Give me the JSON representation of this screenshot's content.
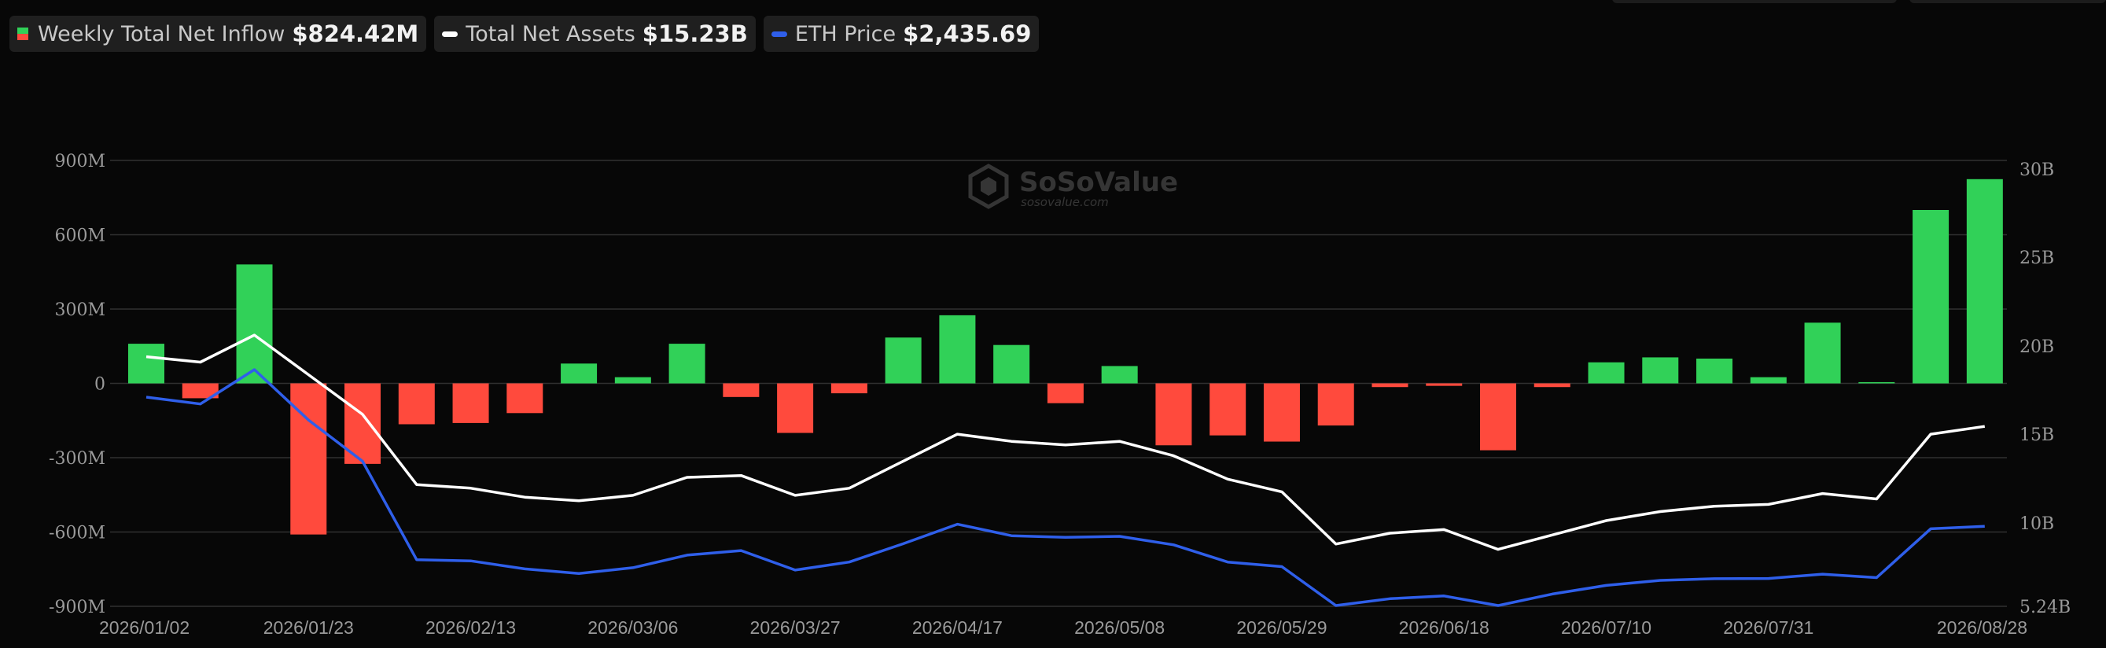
{
  "legend": {
    "inflow_label": "Weekly Total Net Inflow",
    "inflow_value": "$824.42M",
    "assets_label": "Total Net Assets",
    "assets_value": "$15.23B",
    "eth_label": "ETH Price",
    "eth_value": "$2,435.69"
  },
  "watermark": {
    "brand": "SoSoValue",
    "url": "sosovalue.com"
  },
  "colors": {
    "positive": "#31d158",
    "negative": "#ff4a3d",
    "assets_line": "#ffffff",
    "eth_line": "#2f5fea",
    "grid": "#303030",
    "tick_text": "#9a9a9a"
  },
  "chart_data": {
    "type": "bar",
    "x_tick_labels": [
      "2026/01/02",
      "2026/01/23",
      "2026/02/13",
      "2026/03/06",
      "2026/03/27",
      "2026/04/17",
      "2026/05/08",
      "2026/05/29",
      "2026/06/18",
      "2026/07/10",
      "2026/07/31",
      "2026/08/28"
    ],
    "y_left_ticks": [
      "900M",
      "600M",
      "300M",
      "0",
      "-300M",
      "-600M",
      "-900M"
    ],
    "y_left_range_millions": [
      -900,
      900
    ],
    "y_right_ticks": [
      "30B",
      "25B",
      "20B",
      "15B",
      "10B",
      "5.24B"
    ],
    "y_right_range_billions": [
      5.24,
      30
    ],
    "grid": true,
    "series": [
      {
        "name": "Weekly Total Net Inflow",
        "type": "bar",
        "unit": "USD millions",
        "values": [
          160,
          -60,
          480,
          -610,
          -325,
          -165,
          -160,
          -120,
          80,
          25,
          160,
          -55,
          -200,
          -40,
          185,
          275,
          155,
          -80,
          70,
          -250,
          -210,
          -235,
          -170,
          -15,
          -10,
          -270,
          -15,
          85,
          105,
          100,
          25,
          245,
          5,
          700,
          824.42
        ]
      },
      {
        "name": "Total Net Assets",
        "type": "line",
        "unit": "USD billions",
        "values": [
          19.1,
          18.8,
          20.3,
          18.1,
          15.9,
          12.0,
          11.8,
          11.3,
          11.1,
          11.4,
          12.4,
          12.5,
          11.4,
          11.8,
          13.3,
          14.8,
          14.4,
          14.2,
          14.4,
          13.6,
          12.3,
          11.6,
          8.7,
          9.3,
          9.5,
          8.4,
          9.2,
          10.0,
          10.5,
          10.8,
          10.9,
          11.5,
          11.2,
          14.8,
          15.23
        ]
      },
      {
        "name": "ETH Price",
        "type": "line",
        "unit": "USD",
        "values": [
          3000,
          2970,
          3120,
          2900,
          2720,
          2290,
          2285,
          2250,
          2230,
          2255,
          2310,
          2330,
          2245,
          2280,
          2360,
          2445,
          2395,
          2388,
          2392,
          2355,
          2280,
          2260,
          2090,
          2120,
          2132,
          2090,
          2140,
          2178,
          2200,
          2207,
          2208,
          2227,
          2212,
          2425,
          2435.69
        ]
      }
    ],
    "eth_price_axis_hidden": true
  }
}
